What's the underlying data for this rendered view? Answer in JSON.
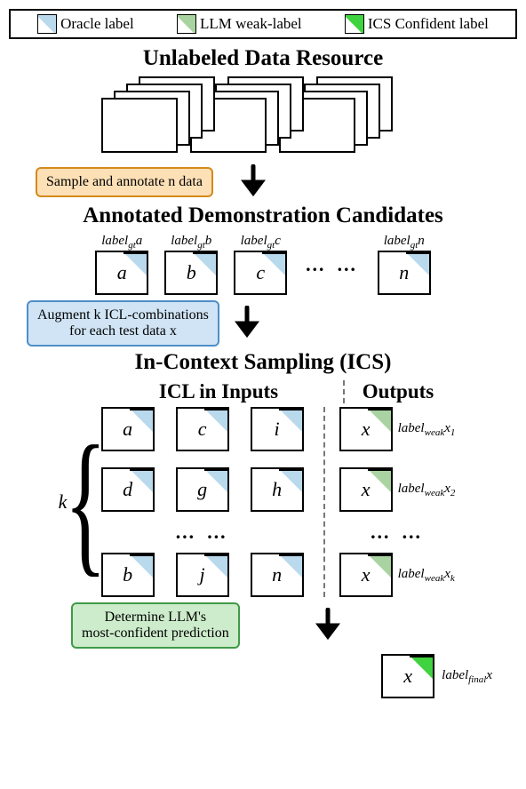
{
  "legend": {
    "oracle": "Oracle label",
    "weak": "LLM weak-label",
    "confident": "ICS Confident label",
    "colors": {
      "oracle": "#b9d9ec",
      "weak": "#a9d3a0",
      "confident": "#3fd33f"
    }
  },
  "titles": {
    "unlabeled": "Unlabeled Data Resource",
    "candidates": "Annotated Demonstration Candidates",
    "ics": "In-Context Sampling (ICS)",
    "icl_inputs": "ICL in Inputs",
    "outputs": "Outputs"
  },
  "steps": {
    "sample": "Sample and annotate n data",
    "augment": "Augment k ICL-combinations\nfor each test data x",
    "determine": "Determine LLM's\nmost-confident prediction"
  },
  "cand": {
    "prefix": "label",
    "sub": "gt",
    "ids": [
      "a",
      "b",
      "c",
      "n"
    ],
    "ellipsis": "…   …"
  },
  "ics": {
    "k": "k",
    "rows": [
      [
        "a",
        "c",
        "i"
      ],
      [
        "d",
        "g",
        "h"
      ],
      [
        "b",
        "j",
        "n"
      ]
    ],
    "ellipsis": "…   …",
    "x": "x",
    "weak_prefix": "label",
    "weak_sub": "weak",
    "weak_ids": [
      "1",
      "2",
      "k"
    ]
  },
  "final": {
    "x": "x",
    "prefix": "label",
    "sub": "final",
    "id": "x"
  }
}
